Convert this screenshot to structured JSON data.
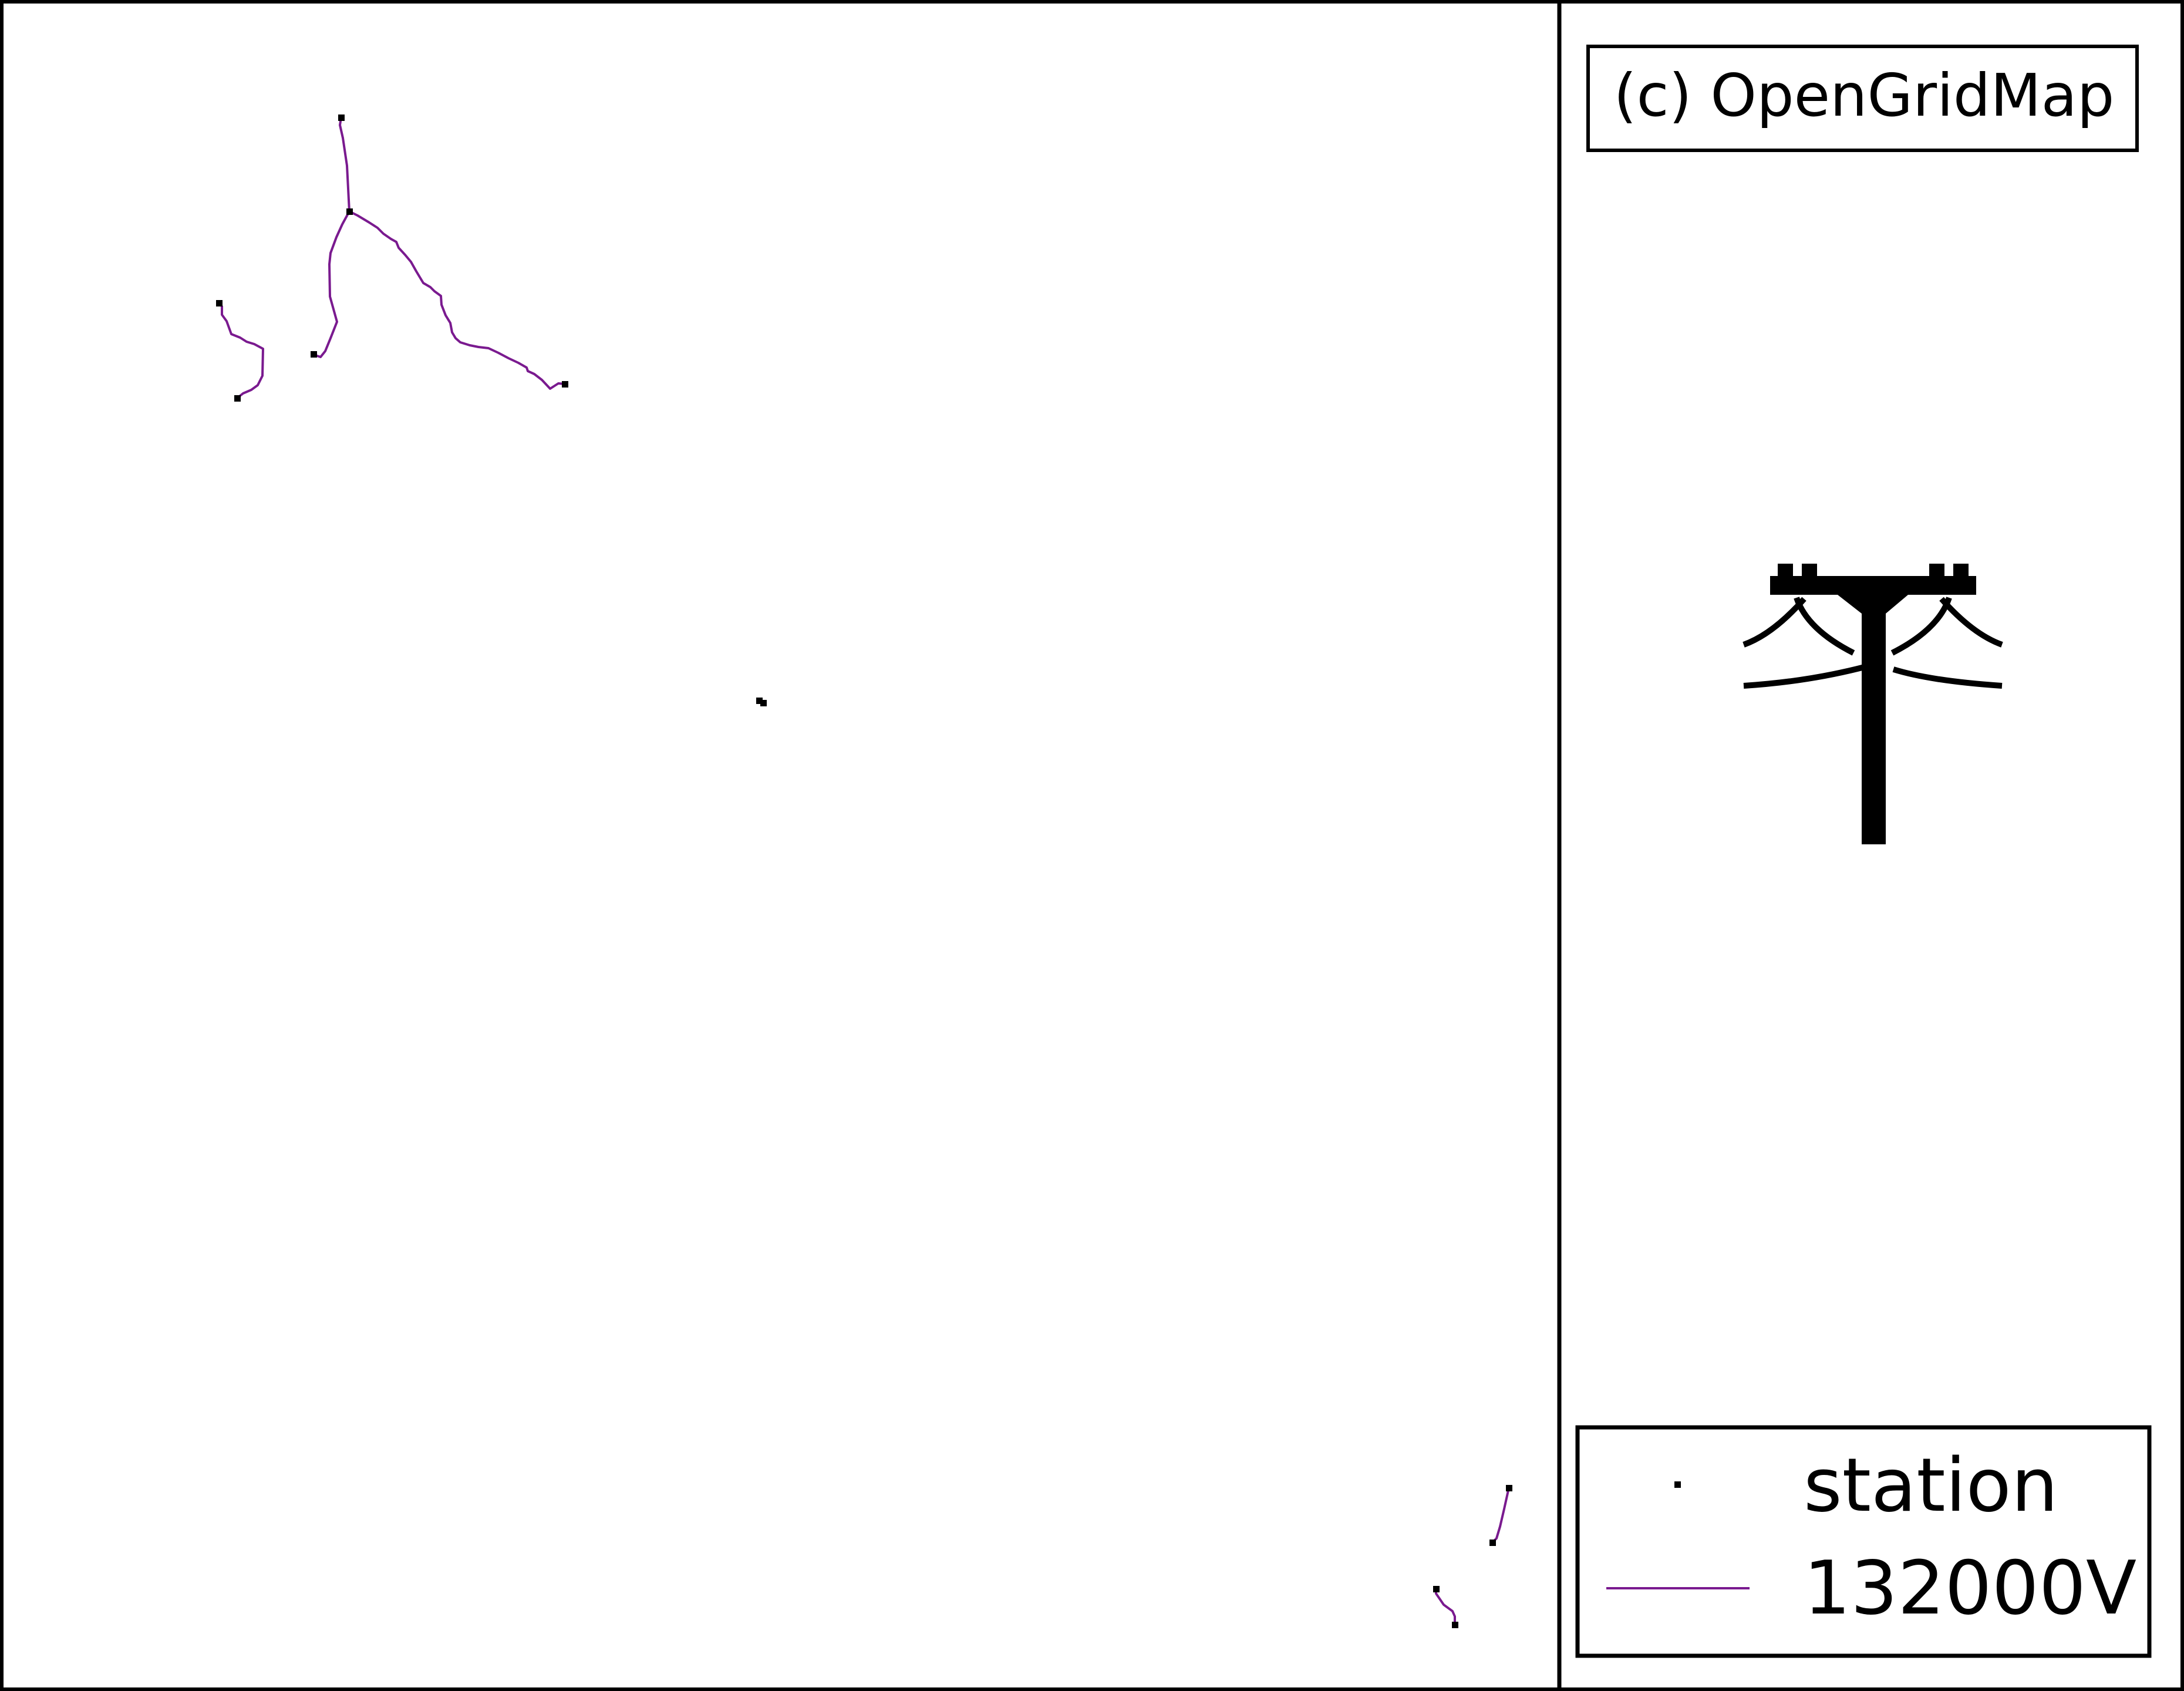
{
  "copyright": "(c) OpenGridMap",
  "logo_icon": "power-pole-icon",
  "legend": {
    "station_label": "station",
    "line_label": "132000V",
    "line_color": "#7a1a8f",
    "station_color": "#000000"
  },
  "colors": {
    "background": "#ffffff",
    "border": "#000000",
    "line_132kv": "#7a1a8f"
  }
}
